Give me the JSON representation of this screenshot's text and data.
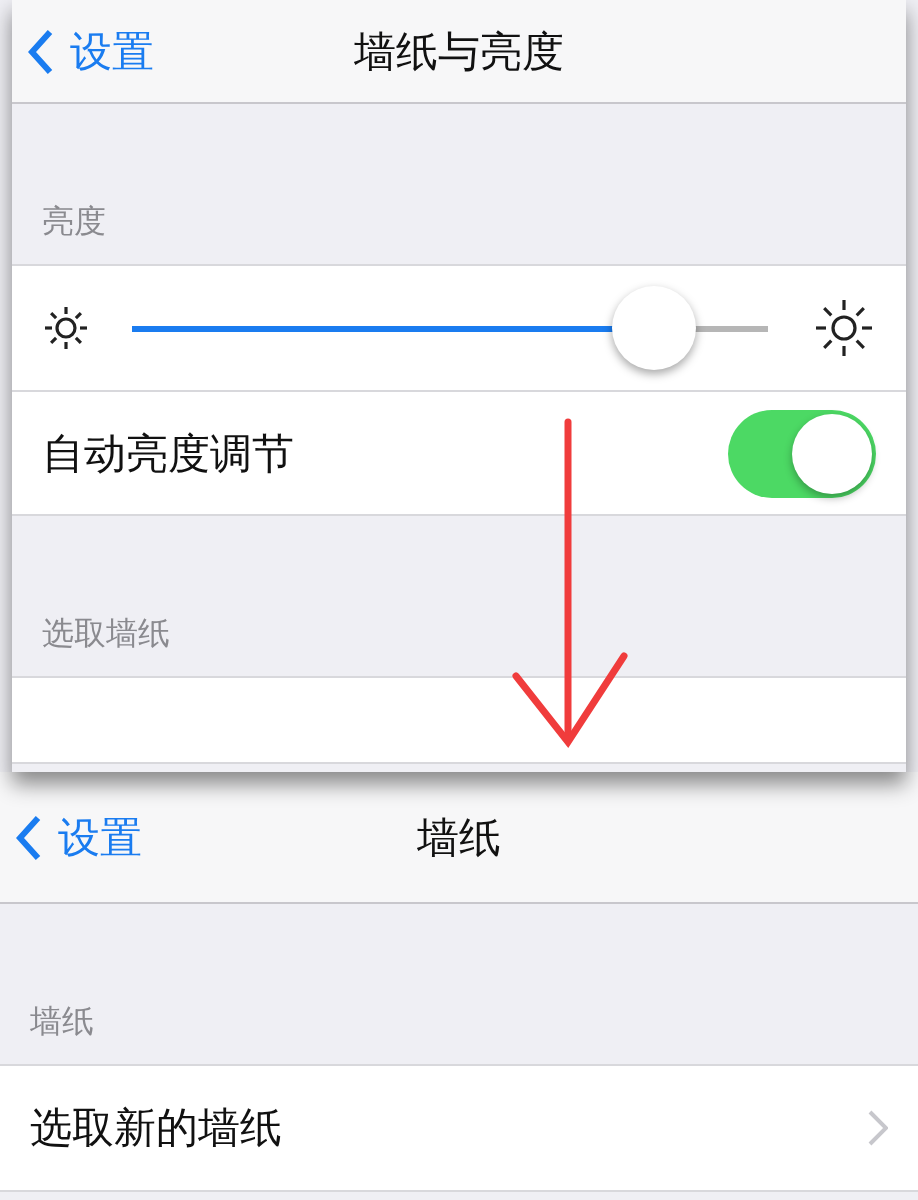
{
  "screens": [
    {
      "nav": {
        "back": "设置",
        "title": "墙纸与亮度"
      },
      "sections": [
        {
          "header": "亮度",
          "rows": [
            {
              "kind": "slider",
              "level": 0.82
            },
            {
              "kind": "toggle",
              "label": "自动亮度调节",
              "on": true
            }
          ]
        },
        {
          "header": "选取墙纸",
          "rows": [
            {
              "kind": "blank"
            }
          ]
        }
      ]
    },
    {
      "nav": {
        "back": "设置",
        "title": "墙纸"
      },
      "sections": [
        {
          "header": "墙纸",
          "rows": [
            {
              "kind": "link",
              "label": "选取新的墙纸"
            }
          ]
        }
      ]
    }
  ]
}
